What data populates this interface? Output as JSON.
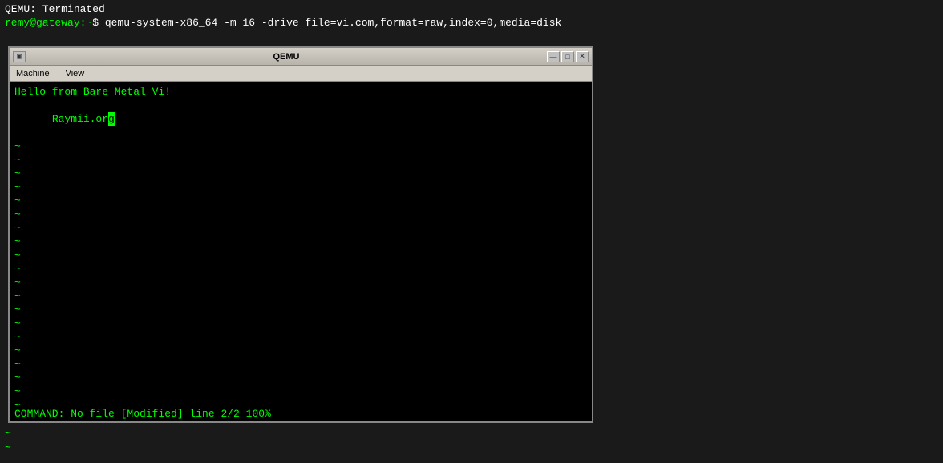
{
  "terminal": {
    "title_line": "QEMU: Terminated",
    "cmd_line": {
      "user": "remy@gateway",
      "separator": ":~",
      "prompt": "$",
      "command": " qemu-system-x86_64 -m 16 -drive file=vi.com,format=raw,index=0,media=disk"
    },
    "tilde1": "~",
    "tilde2": "~"
  },
  "qemu_window": {
    "title": "QEMU",
    "menu": {
      "machine": "Machine",
      "view": "View"
    },
    "controls": {
      "minimize": "—",
      "restore": "□",
      "close": "✕"
    },
    "screen": {
      "line1": "Hello from Bare Metal Vi!",
      "line2_text": "Raymii.or",
      "line2_cursor": "g",
      "tildes": [
        "~",
        "~",
        "~",
        "~",
        "~",
        "~",
        "~",
        "~",
        "~",
        "~",
        "~",
        "~",
        "~",
        "~",
        "~",
        "~",
        "~",
        "~",
        "~",
        "~",
        "~",
        "~",
        "~",
        "~"
      ],
      "statusbar": "COMMAND: No file [Modified] line 2/2 100%"
    }
  }
}
